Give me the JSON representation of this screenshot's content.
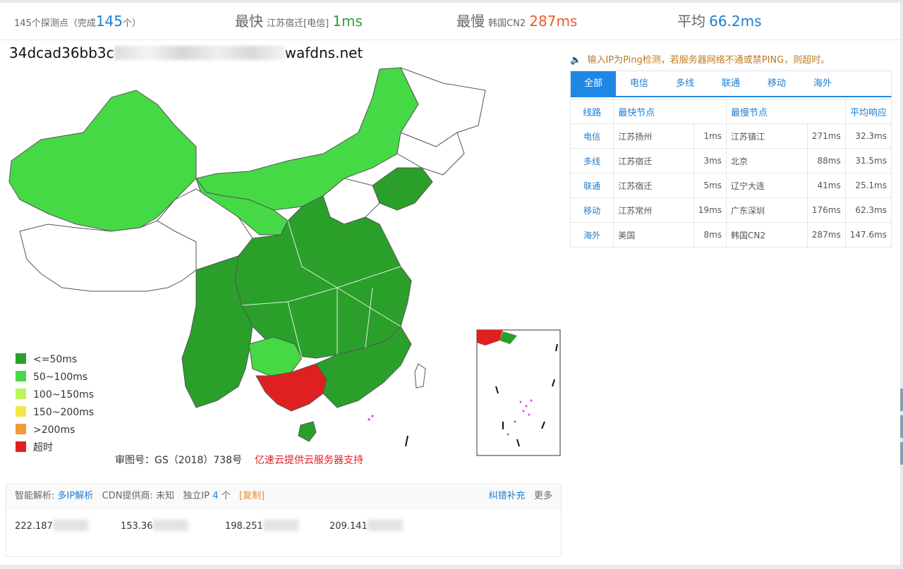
{
  "summary": {
    "probes_prefix": "145个探测点（完成",
    "probes_count": "145",
    "probes_suffix": "个）",
    "fastest_label": "最快",
    "fastest_node": "江苏宿迁[电信]",
    "fastest_value": "1ms",
    "slowest_label": "最慢",
    "slowest_node": "韩国CN2",
    "slowest_value": "287ms",
    "average_label": "平均",
    "average_value": "66.2ms"
  },
  "domain": {
    "prefix": "34dcad36bb3c",
    "suffix": "wafdns.net"
  },
  "legend": [
    {
      "label": "<=50ms",
      "color": "#2aa02a"
    },
    {
      "label": "50~100ms",
      "color": "#46d946"
    },
    {
      "label": "100~150ms",
      "color": "#bff55a"
    },
    {
      "label": "150~200ms",
      "color": "#f2e64a"
    },
    {
      "label": ">200ms",
      "color": "#f2993a"
    },
    {
      "label": "超时",
      "color": "#e02020"
    }
  ],
  "map_footer": {
    "license": "审图号：GS（2018）738号",
    "sponsor": "亿速云提供云服务器支持"
  },
  "map_colors": {
    "fast": "#2aa02a",
    "medium": "#46d946",
    "timeout": "#e02020",
    "none": "#ffffff"
  },
  "notice": "输入IP为Ping检测，若服务器网络不通或禁PING，则超时。",
  "tabs": [
    "全部",
    "电信",
    "多线",
    "联通",
    "移动",
    "海外"
  ],
  "table": {
    "headers": [
      "线路",
      "最快节点",
      "最慢节点",
      "平均响应"
    ],
    "rows": [
      {
        "line": "电信",
        "fast_node": "江苏扬州",
        "fast_ms": "1ms",
        "slow_node": "江苏镇江",
        "slow_ms": "271ms",
        "avg": "32.3ms"
      },
      {
        "line": "多线",
        "fast_node": "江苏宿迁",
        "fast_ms": "3ms",
        "slow_node": "北京",
        "slow_ms": "88ms",
        "avg": "31.5ms"
      },
      {
        "line": "联通",
        "fast_node": "江苏宿迁",
        "fast_ms": "5ms",
        "slow_node": "辽宁大连",
        "slow_ms": "41ms",
        "avg": "25.1ms"
      },
      {
        "line": "移动",
        "fast_node": "江苏常州",
        "fast_ms": "19ms",
        "slow_node": "广东深圳",
        "slow_ms": "176ms",
        "avg": "62.3ms"
      },
      {
        "line": "海外",
        "fast_node": "美国",
        "fast_ms": "8ms",
        "slow_node": "韩国CN2",
        "slow_ms": "287ms",
        "avg": "147.6ms"
      }
    ]
  },
  "dns": {
    "smart_label": "智能解析:",
    "smart_link": "多IP解析",
    "cdn_label": "CDN提供商: 未知",
    "ip_label": "独立IP",
    "ip_count": "4",
    "ip_unit": "个",
    "copy": "[复制]",
    "report": "纠错补充",
    "more": "更多",
    "ips": [
      "222.187",
      "153.36",
      "198.251",
      "209.141"
    ]
  }
}
